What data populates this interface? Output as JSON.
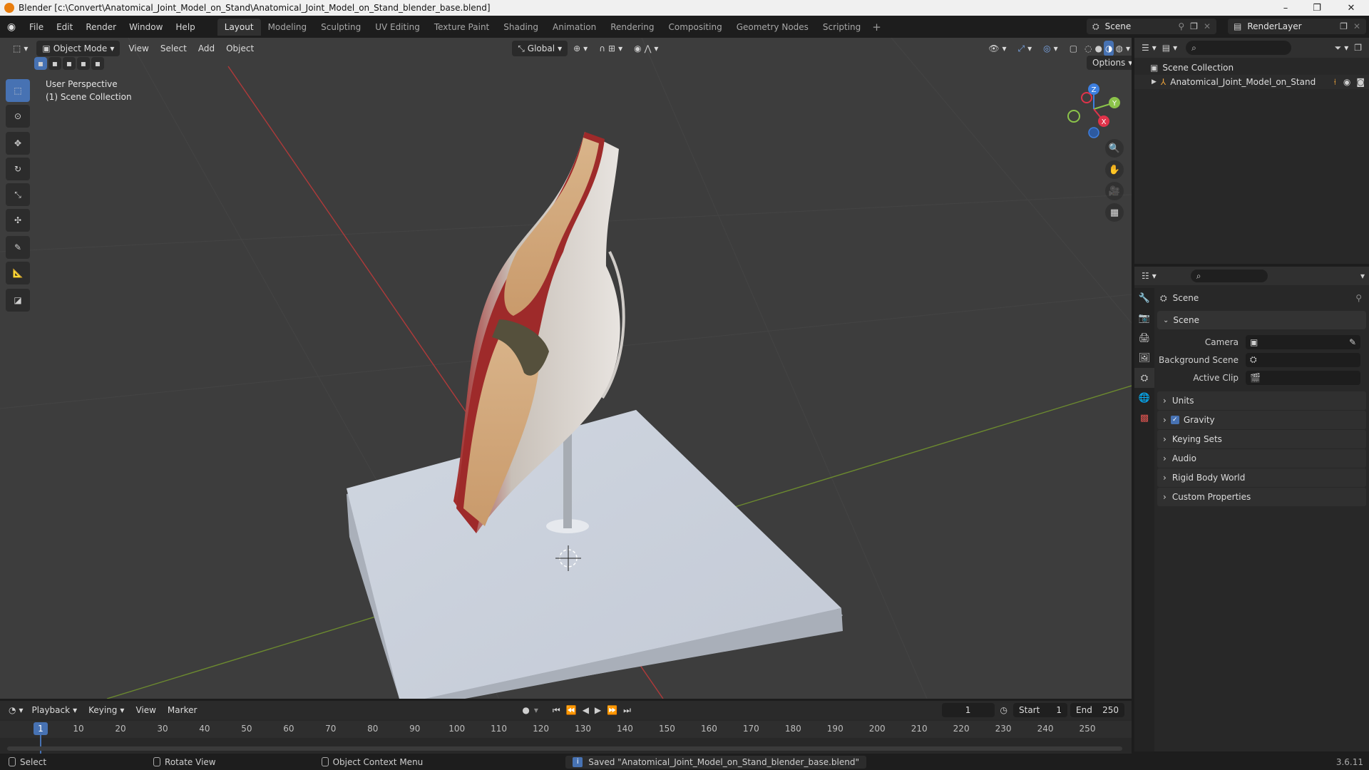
{
  "titlebar": {
    "title": "Blender [c:\\Convert\\Anatomical_Joint_Model_on_Stand\\Anatomical_Joint_Model_on_Stand_blender_base.blend]",
    "minimize": "–",
    "maximize": "❐",
    "close": "✕"
  },
  "menu": [
    "File",
    "Edit",
    "Render",
    "Window",
    "Help"
  ],
  "workspaces": [
    "Layout",
    "Modeling",
    "Sculpting",
    "UV Editing",
    "Texture Paint",
    "Shading",
    "Animation",
    "Rendering",
    "Compositing",
    "Geometry Nodes",
    "Scripting"
  ],
  "workspace_add": "+",
  "scene_name": "Scene",
  "view_layer": "RenderLayer",
  "viewport": {
    "mode": "Object Mode",
    "menus": [
      "View",
      "Select",
      "Add",
      "Object"
    ],
    "transform_orientation": "Global",
    "options": "Options",
    "info_line1": "User Perspective",
    "info_line2": "(1) Scene Collection",
    "gizmo_axes": {
      "z": "Z",
      "y": "Y",
      "x": "X"
    }
  },
  "outliner": {
    "root": "Scene Collection",
    "object": "Anatomical_Joint_Model_on_Stand"
  },
  "properties": {
    "header": "Scene",
    "panel": "Scene",
    "fields": [
      {
        "label": "Camera",
        "value": ""
      },
      {
        "label": "Background Scene",
        "value": ""
      },
      {
        "label": "Active Clip",
        "value": ""
      }
    ],
    "sections": [
      "Units",
      "Gravity",
      "Keying Sets",
      "Audio",
      "Rigid Body World",
      "Custom Properties"
    ],
    "gravity_checked": true
  },
  "timeline": {
    "menus": [
      "Playback",
      "Keying",
      "View",
      "Marker"
    ],
    "current_frame": "1",
    "start_label": "Start",
    "start": "1",
    "end_label": "End",
    "end": "250",
    "ticks": [
      "1",
      "10",
      "20",
      "30",
      "40",
      "50",
      "60",
      "70",
      "80",
      "90",
      "100",
      "110",
      "120",
      "130",
      "140",
      "150",
      "160",
      "170",
      "180",
      "190",
      "200",
      "210",
      "220",
      "230",
      "240",
      "250"
    ]
  },
  "status": {
    "select": "Select",
    "rotate": "Rotate View",
    "context": "Object Context Menu",
    "message": "Saved \"Anatomical_Joint_Model_on_Stand_blender_base.blend\"",
    "version": "3.6.11"
  },
  "colors": {
    "accent": "#4772b3",
    "x_axis": "#e0334a",
    "y_axis": "#8bc34a",
    "z_axis": "#3d7fe0"
  }
}
